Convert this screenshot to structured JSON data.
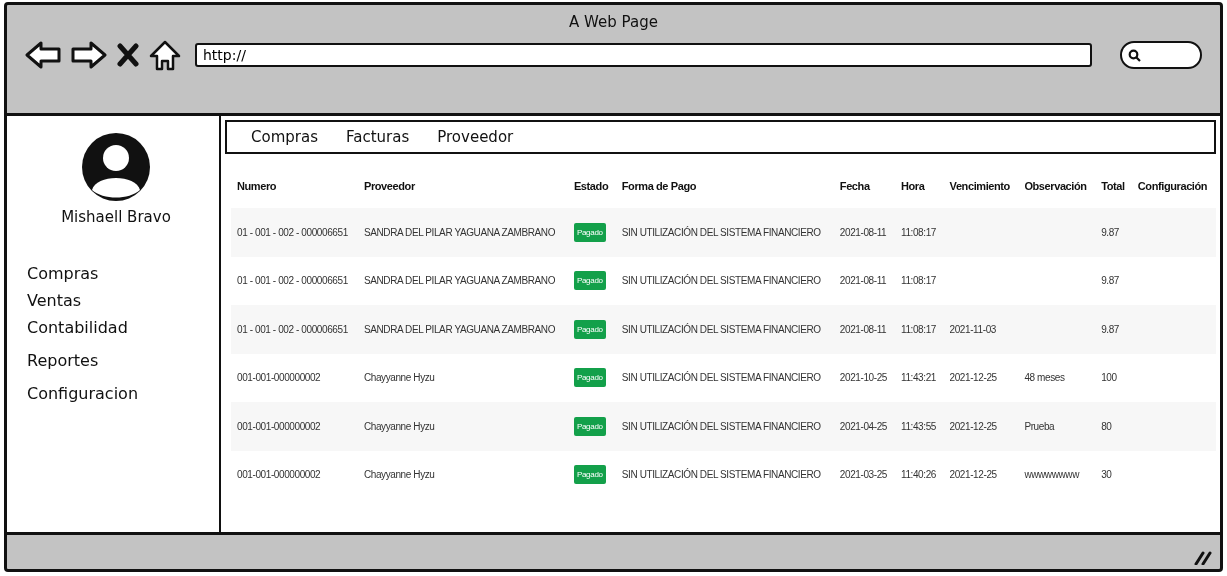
{
  "window": {
    "title": "A Web Page"
  },
  "address_bar": {
    "value": "http://"
  },
  "sidebar": {
    "user_name": "Mishaell Bravo",
    "items": [
      "Compras",
      "Ventas",
      "Contabilidad",
      "Reportes",
      "Configuracion"
    ]
  },
  "tabs": [
    "Compras",
    "Facturas",
    "Proveedor"
  ],
  "table": {
    "columns": [
      "Numero",
      "Proveedor",
      "Estado",
      "Forma de Pago",
      "Fecha",
      "Hora",
      "Vencimiento",
      "Observación",
      "Total",
      "Configuración"
    ],
    "rows": [
      {
        "numero": "01 - 001 - 002 - 000006651",
        "proveedor": "SANDRA DEL PILAR YAGUANA ZAMBRANO",
        "estado": "Pagado",
        "forma_de_pago": "SIN UTILIZACIÓN DEL SISTEMA FINANCIERO",
        "fecha": "2021-08-11",
        "hora": "11:08:17",
        "total": "9.87"
      },
      {
        "numero": "01 - 001 - 002 - 000006651",
        "proveedor": "SANDRA DEL PILAR YAGUANA ZAMBRANO",
        "estado": "Pagado",
        "forma_de_pago": "SIN UTILIZACIÓN DEL SISTEMA FINANCIERO",
        "fecha": "2021-08-11",
        "hora": "11:08:17",
        "total": "9.87"
      },
      {
        "numero": "01 - 001 - 002 - 000006651",
        "proveedor": "SANDRA DEL PILAR YAGUANA ZAMBRANO",
        "estado": "Pagado",
        "forma_de_pago": "SIN UTILIZACIÓN DEL SISTEMA FINANCIERO",
        "fecha": "2021-08-11",
        "hora": "11:08:17",
        "vencimiento": "2021-11-03",
        "total": "9.87"
      },
      {
        "numero": "001-001-000000002",
        "proveedor": "Chayyanne Hyzu",
        "estado": "Pagado",
        "forma_de_pago": "SIN UTILIZACIÓN DEL SISTEMA FINANCIERO",
        "fecha": "2021-10-25",
        "hora": "11:43:21",
        "vencimiento": "2021-12-25",
        "observacion": "48 meses",
        "total": "100"
      },
      {
        "numero": "001-001-000000002",
        "proveedor": "Chayyanne Hyzu",
        "estado": "Pagado",
        "forma_de_pago": "SIN UTILIZACIÓN DEL SISTEMA FINANCIERO",
        "fecha": "2021-04-25",
        "hora": "11:43:55",
        "vencimiento": "2021-12-25",
        "observacion": "Prueba",
        "total": "80"
      },
      {
        "numero": "001-001-000000002",
        "proveedor": "Chayyanne Hyzu",
        "estado": "Pagado",
        "forma_de_pago": "SIN UTILIZACIÓN DEL SISTEMA FINANCIERO",
        "fecha": "2021-03-25",
        "hora": "11:40:26",
        "vencimiento": "2021-12-25",
        "observacion": "wwwwwwww",
        "total": "30"
      }
    ]
  }
}
